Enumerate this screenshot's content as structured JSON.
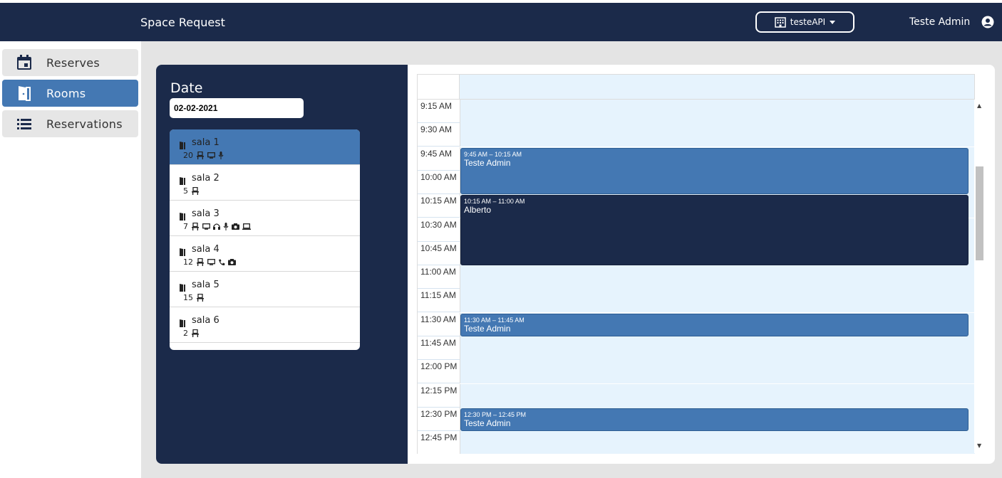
{
  "header": {
    "app_title": "Space Request",
    "tenant_label": "testeAPI",
    "user_name": "Teste Admin"
  },
  "sidebar": {
    "items": [
      {
        "label": "Reserves",
        "icon": "calendar-icon",
        "active": false
      },
      {
        "label": "Rooms",
        "icon": "door-icon",
        "active": true
      },
      {
        "label": "Reservations",
        "icon": "list-icon",
        "active": false
      }
    ]
  },
  "date_panel": {
    "label": "Date",
    "value": "02-02-2021"
  },
  "rooms": [
    {
      "name": "sala 1",
      "capacity": "20",
      "features": [
        "monitor-icon",
        "mic-icon"
      ],
      "selected": true
    },
    {
      "name": "sala 2",
      "capacity": "5",
      "features": [],
      "selected": false
    },
    {
      "name": "sala 3",
      "capacity": "7",
      "features": [
        "monitor-icon",
        "headset-icon",
        "mic-icon",
        "camera-icon",
        "laptop-icon"
      ],
      "selected": false
    },
    {
      "name": "sala 4",
      "capacity": "12",
      "features": [
        "monitor-icon",
        "phone-icon",
        "camera-icon"
      ],
      "selected": false
    },
    {
      "name": "sala 5",
      "capacity": "15",
      "features": [],
      "selected": false
    },
    {
      "name": "sala 6",
      "capacity": "2",
      "features": [],
      "selected": false
    }
  ],
  "calendar": {
    "time_slots": [
      "9:15 AM",
      "9:30 AM",
      "9:45 AM",
      "10:00 AM",
      "10:15 AM",
      "10:30 AM",
      "10:45 AM",
      "11:00 AM",
      "11:15 AM",
      "11:30 AM",
      "11:45 AM",
      "12:00 PM",
      "12:15 PM",
      "12:30 PM",
      "12:45 PM"
    ],
    "events": [
      {
        "time": "9:45 AM – 10:15 AM",
        "title": "Teste Admin",
        "style": "light"
      },
      {
        "time": "10:15 AM – 11:00 AM",
        "title": "Alberto",
        "style": "dark"
      },
      {
        "time": "11:30 AM – 11:45 AM",
        "title": "Teste Admin",
        "style": "light"
      },
      {
        "time": "12:30 PM – 12:45 PM",
        "title": "Teste Admin",
        "style": "light"
      }
    ]
  },
  "colors": {
    "navy": "#1b2a4a",
    "accent_blue": "#4478b3",
    "slot_bg": "#e6f3fd"
  }
}
